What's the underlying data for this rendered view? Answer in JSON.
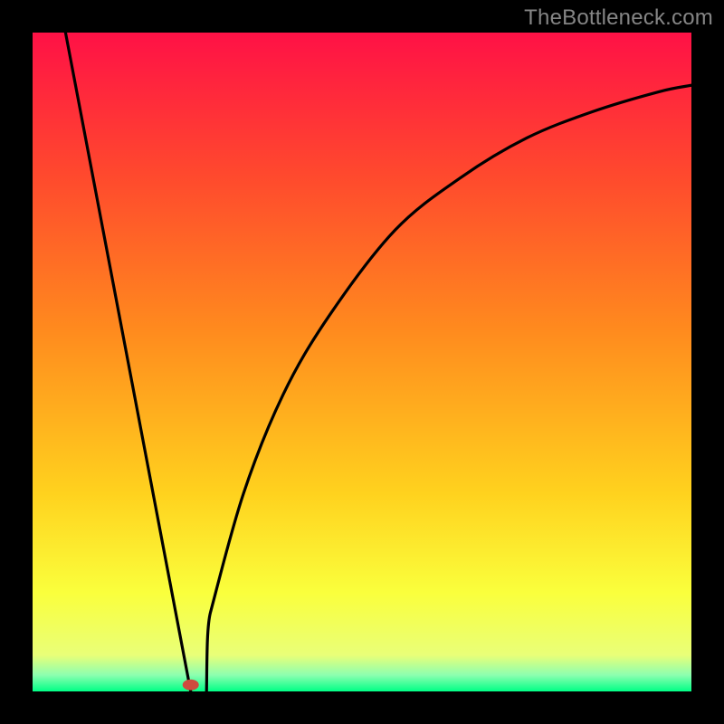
{
  "watermark": "TheBottleneck.com",
  "chart_data": {
    "type": "line",
    "title": "",
    "xlabel": "",
    "ylabel": "",
    "xlim": [
      0,
      100
    ],
    "ylim": [
      0,
      100
    ],
    "grid": false,
    "legend": false,
    "gradient_stops": [
      {
        "offset": 0.0,
        "color": "#ff1146"
      },
      {
        "offset": 0.22,
        "color": "#ff4a2d"
      },
      {
        "offset": 0.45,
        "color": "#ff8a1e"
      },
      {
        "offset": 0.7,
        "color": "#ffd21e"
      },
      {
        "offset": 0.85,
        "color": "#faff3c"
      },
      {
        "offset": 0.945,
        "color": "#e9ff78"
      },
      {
        "offset": 0.975,
        "color": "#8dffb0"
      },
      {
        "offset": 1.0,
        "color": "#00ff86"
      }
    ],
    "marker": {
      "x": 24,
      "y": 1,
      "color": "#ce4a3e"
    },
    "series": [
      {
        "name": "curve",
        "x": [
          5,
          24,
          27,
          32,
          38,
          45,
          55,
          65,
          75,
          85,
          95,
          100
        ],
        "y": [
          100,
          0,
          12,
          30,
          45,
          57,
          70,
          78,
          84,
          88,
          91,
          92
        ]
      }
    ]
  }
}
